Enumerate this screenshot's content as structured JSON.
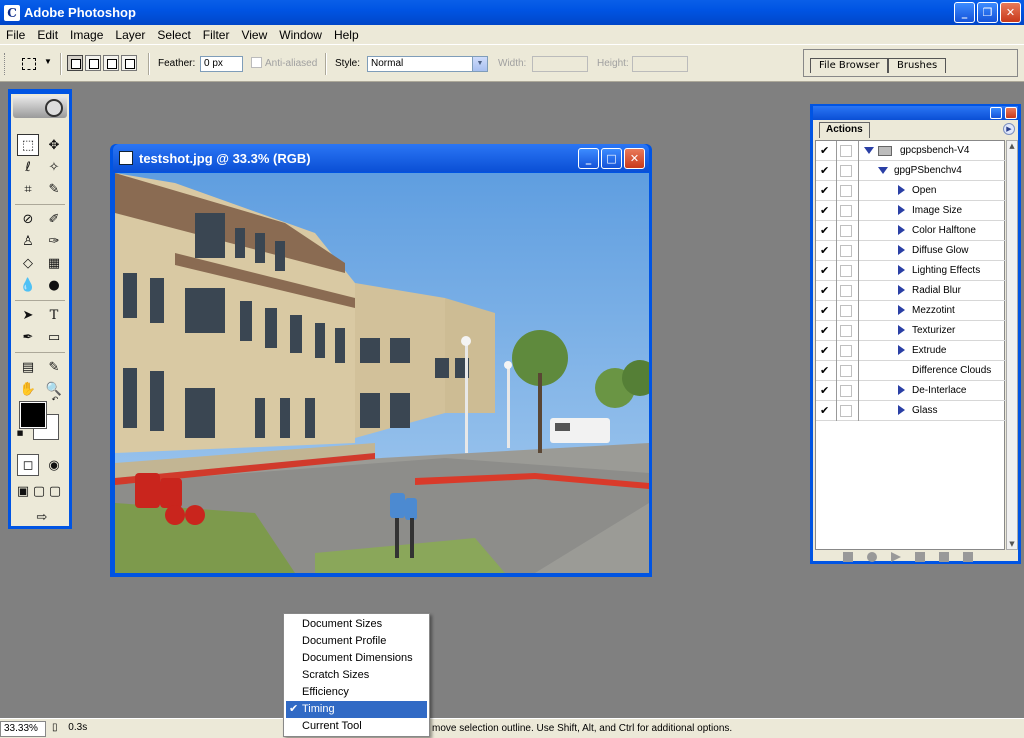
{
  "app": {
    "title": "Adobe Photoshop",
    "icon": "photoshop-icon"
  },
  "menu": [
    "File",
    "Edit",
    "Image",
    "Layer",
    "Select",
    "Filter",
    "View",
    "Window",
    "Help"
  ],
  "options": {
    "feather_label": "Feather:",
    "feather_value": "0 px",
    "antialiased_label": "Anti-aliased",
    "style_label": "Style:",
    "style_value": "Normal",
    "width_label": "Width:",
    "height_label": "Height:"
  },
  "palette_well": {
    "tabs": [
      "File Browser",
      "Brushes"
    ]
  },
  "document": {
    "title": "testshot.jpg @ 33.3% (RGB)"
  },
  "actions_panel": {
    "tab": "Actions",
    "items": [
      {
        "label": "gpcpsbench-V4",
        "level": 0,
        "expanded": true,
        "type": "set"
      },
      {
        "label": "gpgPSbenchv4",
        "level": 1,
        "expanded": true,
        "type": "action"
      },
      {
        "label": "Open",
        "level": 2,
        "type": "step"
      },
      {
        "label": "Image Size",
        "level": 2,
        "type": "step"
      },
      {
        "label": "Color Halftone",
        "level": 2,
        "type": "step"
      },
      {
        "label": "Diffuse Glow",
        "level": 2,
        "type": "step"
      },
      {
        "label": "Lighting Effects",
        "level": 2,
        "type": "step"
      },
      {
        "label": "Radial Blur",
        "level": 2,
        "type": "step"
      },
      {
        "label": "Mezzotint",
        "level": 2,
        "type": "step"
      },
      {
        "label": "Texturizer",
        "level": 2,
        "type": "step"
      },
      {
        "label": "Extrude",
        "level": 2,
        "type": "step"
      },
      {
        "label": "Difference Clouds",
        "level": 2,
        "type": "step-noexpand"
      },
      {
        "label": "De-Interlace",
        "level": 2,
        "type": "step"
      },
      {
        "label": "Glass",
        "level": 2,
        "type": "step"
      }
    ]
  },
  "status": {
    "zoom": "33.33%",
    "doc_info": "0.3s",
    "message": "move selection outline.  Use Shift, Alt, and Ctrl for additional options."
  },
  "popup_menu": {
    "items": [
      "Document Sizes",
      "Document Profile",
      "Document Dimensions",
      "Scratch Sizes",
      "Efficiency",
      "Timing",
      "Current Tool"
    ],
    "selected": "Timing"
  },
  "colors": {
    "xp_blue": "#0054e3",
    "chrome": "#ece9d8",
    "workspace": "#808080",
    "selection": "#316ac5"
  }
}
